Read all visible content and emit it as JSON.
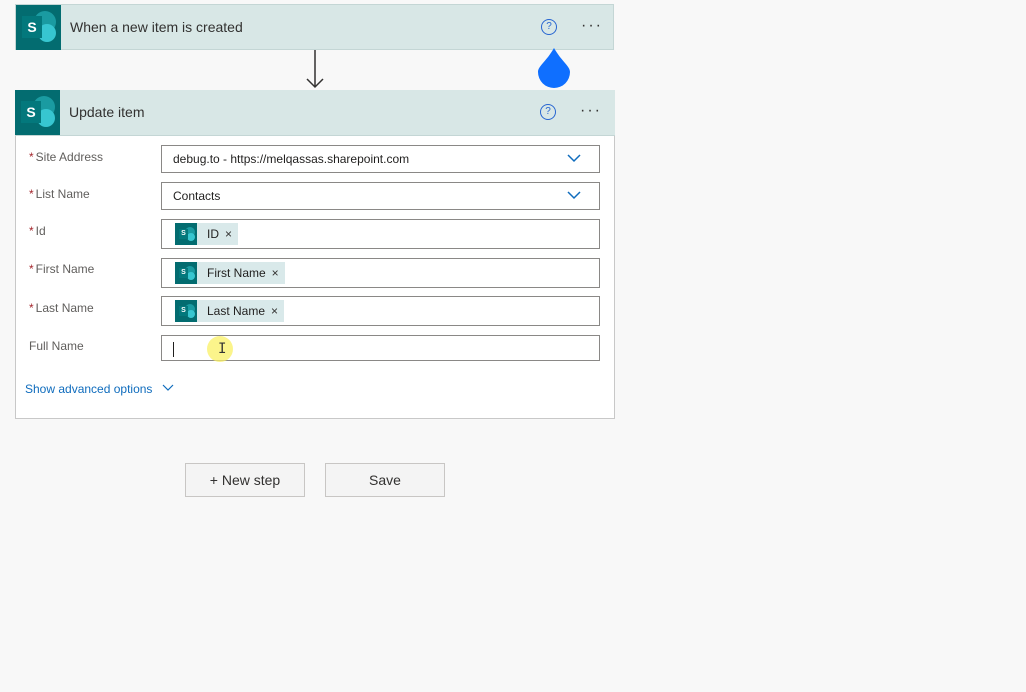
{
  "trigger": {
    "title": "When a new item is created",
    "logo_letter": "S",
    "help_glyph": "?",
    "more_glyph": "···"
  },
  "action": {
    "title": "Update item",
    "logo_letter": "S",
    "help_glyph": "?",
    "more_glyph": "···",
    "fields": {
      "site_address": {
        "label": "Site Address",
        "required": "*",
        "value": "debug.to - https://melqassas.sharepoint.com"
      },
      "list_name": {
        "label": "List Name",
        "required": "*",
        "value": "Contacts"
      },
      "id": {
        "label": "Id",
        "required": "*",
        "token": "ID"
      },
      "first_name": {
        "label": "First Name",
        "required": "*",
        "token": "First Name"
      },
      "last_name": {
        "label": "Last Name",
        "required": "*",
        "token": "Last Name"
      },
      "full_name": {
        "label": "Full Name",
        "value": ""
      }
    },
    "advanced_link": "Show advanced options",
    "token_remove_glyph": "×"
  },
  "buttons": {
    "new_step": "+ New step",
    "save": "Save"
  },
  "colors": {
    "header_bg": "#d8e7e6",
    "sharepoint_teal": "#036c70",
    "accent_blue": "#0f6cbd",
    "drop_blue": "#0f6fff"
  },
  "icons": {
    "logo": "sharepoint-logo-icon",
    "help": "help-circle-icon",
    "more": "more-ellipsis-icon",
    "arrow": "arrow-down-icon",
    "chevron": "chevron-down-icon",
    "remove": "close-icon"
  }
}
